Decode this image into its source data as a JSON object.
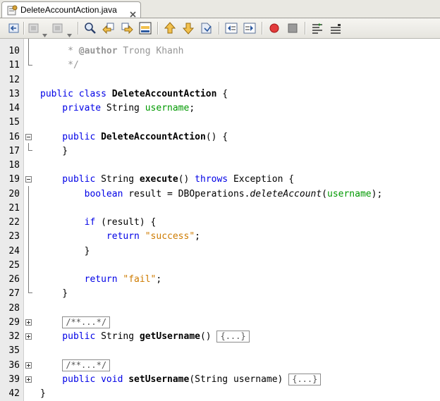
{
  "tab": {
    "label": "DeleteAccountAction.java"
  },
  "toolbar": {
    "buttons": [
      "last-edit-icon",
      "back-icon",
      "forward-icon",
      "find-selection-icon",
      "find-previous-icon",
      "find-next-icon",
      "toggle-highlight-icon",
      "previous-bookmark-icon",
      "next-bookmark-icon",
      "toggle-bookmark-icon",
      "shift-left-icon",
      "shift-right-icon",
      "start-macro-icon",
      "stop-macro-icon",
      "comment-icon",
      "uncomment-icon"
    ]
  },
  "editor": {
    "lines": [
      {
        "num": "10",
        "tokens": [
          {
            "t": "     * ",
            "c": "cm"
          },
          {
            "t": "@author",
            "c": "cmb"
          },
          {
            "t": " Trong Khanh",
            "c": "cm"
          }
        ]
      },
      {
        "num": "11",
        "tokens": [
          {
            "t": "     */",
            "c": "cm"
          }
        ]
      },
      {
        "num": "12",
        "tokens": []
      },
      {
        "num": "13",
        "tokens": [
          {
            "t": "public class ",
            "c": "kw"
          },
          {
            "t": "DeleteAccountAction",
            "c": "cls"
          },
          {
            "t": " {",
            "c": ""
          }
        ]
      },
      {
        "num": "14",
        "tokens": [
          {
            "t": "    private ",
            "c": "kw"
          },
          {
            "t": "String ",
            "c": ""
          },
          {
            "t": "username",
            "c": "fld"
          },
          {
            "t": ";",
            "c": ""
          }
        ]
      },
      {
        "num": "15",
        "tokens": []
      },
      {
        "num": "16",
        "tokens": [
          {
            "t": "    public ",
            "c": "kw"
          },
          {
            "t": "DeleteAccountAction",
            "c": "cls"
          },
          {
            "t": "() {",
            "c": ""
          }
        ]
      },
      {
        "num": "17",
        "tokens": [
          {
            "t": "    }",
            "c": ""
          }
        ]
      },
      {
        "num": "18",
        "tokens": []
      },
      {
        "num": "19",
        "tokens": [
          {
            "t": "    public ",
            "c": "kw"
          },
          {
            "t": "String ",
            "c": ""
          },
          {
            "t": "execute",
            "c": "cls"
          },
          {
            "t": "() ",
            "c": ""
          },
          {
            "t": "throws",
            "c": "kw"
          },
          {
            "t": " Exception {",
            "c": ""
          }
        ]
      },
      {
        "num": "20",
        "tokens": [
          {
            "t": "        boolean ",
            "c": "kw"
          },
          {
            "t": "result = DBOperations.",
            "c": ""
          },
          {
            "t": "deleteAccount",
            "c": "it"
          },
          {
            "t": "(",
            "c": ""
          },
          {
            "t": "username",
            "c": "fld"
          },
          {
            "t": ");",
            "c": ""
          }
        ]
      },
      {
        "num": "21",
        "tokens": []
      },
      {
        "num": "22",
        "tokens": [
          {
            "t": "        if ",
            "c": "kw"
          },
          {
            "t": "(result) {",
            "c": ""
          }
        ]
      },
      {
        "num": "23",
        "tokens": [
          {
            "t": "            return ",
            "c": "kw"
          },
          {
            "t": "\"success\"",
            "c": "str"
          },
          {
            "t": ";",
            "c": ""
          }
        ]
      },
      {
        "num": "24",
        "tokens": [
          {
            "t": "        }",
            "c": ""
          }
        ]
      },
      {
        "num": "25",
        "tokens": []
      },
      {
        "num": "26",
        "tokens": [
          {
            "t": "        return ",
            "c": "kw"
          },
          {
            "t": "\"fail\"",
            "c": "str"
          },
          {
            "t": ";",
            "c": ""
          }
        ]
      },
      {
        "num": "27",
        "tokens": [
          {
            "t": "    }",
            "c": ""
          }
        ]
      },
      {
        "num": "28",
        "tokens": []
      },
      {
        "num": "29",
        "tokens": [
          {
            "t": "    ",
            "c": ""
          },
          {
            "t": "/**...*/",
            "c": "box"
          }
        ]
      },
      {
        "num": "32",
        "tokens": [
          {
            "t": "    public ",
            "c": "kw"
          },
          {
            "t": "String ",
            "c": ""
          },
          {
            "t": "getUsername",
            "c": "cls"
          },
          {
            "t": "() ",
            "c": ""
          },
          {
            "t": "{...}",
            "c": "box"
          }
        ]
      },
      {
        "num": "35",
        "tokens": []
      },
      {
        "num": "36",
        "tokens": [
          {
            "t": "    ",
            "c": ""
          },
          {
            "t": "/**...*/",
            "c": "box"
          }
        ]
      },
      {
        "num": "39",
        "tokens": [
          {
            "t": "    public void ",
            "c": "kw"
          },
          {
            "t": "setUsername",
            "c": "cls"
          },
          {
            "t": "(String username) ",
            "c": ""
          },
          {
            "t": "{...}",
            "c": "box"
          }
        ]
      },
      {
        "num": "42",
        "tokens": [
          {
            "t": "}",
            "c": ""
          }
        ]
      }
    ]
  },
  "colors": {
    "keyword": "#0000e6",
    "field": "#009900",
    "string": "#ce7b00",
    "comment": "#969696",
    "gutter": "#ebebeb"
  }
}
